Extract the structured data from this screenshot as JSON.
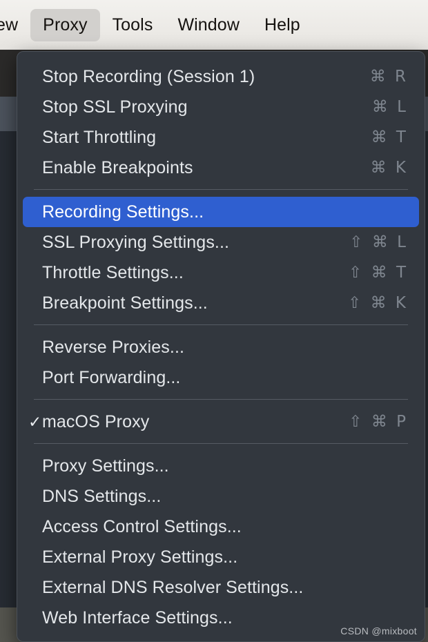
{
  "menubar": {
    "items": [
      {
        "label": "ew",
        "active": false,
        "truncated": true
      },
      {
        "label": "Proxy",
        "active": true,
        "truncated": false
      },
      {
        "label": "Tools",
        "active": false,
        "truncated": false
      },
      {
        "label": "Window",
        "active": false,
        "truncated": false
      },
      {
        "label": "Help",
        "active": false,
        "truncated": false
      }
    ]
  },
  "dropdown": {
    "title": "Proxy",
    "highlight_color": "#2f5fd0",
    "groups": [
      {
        "items": [
          {
            "label": "Stop Recording (Session 1)",
            "shortcut": "⌘ R",
            "checked": false,
            "highlighted": false
          },
          {
            "label": "Stop SSL Proxying",
            "shortcut": "⌘ L",
            "checked": false,
            "highlighted": false
          },
          {
            "label": "Start Throttling",
            "shortcut": "⌘ T",
            "checked": false,
            "highlighted": false
          },
          {
            "label": "Enable Breakpoints",
            "shortcut": "⌘ K",
            "checked": false,
            "highlighted": false
          }
        ]
      },
      {
        "items": [
          {
            "label": "Recording Settings...",
            "shortcut": "",
            "checked": false,
            "highlighted": true
          },
          {
            "label": "SSL Proxying Settings...",
            "shortcut": "⇧ ⌘ L",
            "checked": false,
            "highlighted": false
          },
          {
            "label": "Throttle Settings...",
            "shortcut": "⇧ ⌘ T",
            "checked": false,
            "highlighted": false
          },
          {
            "label": "Breakpoint Settings...",
            "shortcut": "⇧ ⌘ K",
            "checked": false,
            "highlighted": false
          }
        ]
      },
      {
        "items": [
          {
            "label": "Reverse Proxies...",
            "shortcut": "",
            "checked": false,
            "highlighted": false
          },
          {
            "label": "Port Forwarding...",
            "shortcut": "",
            "checked": false,
            "highlighted": false
          }
        ]
      },
      {
        "items": [
          {
            "label": "macOS Proxy",
            "shortcut": "⇧ ⌘ P",
            "checked": true,
            "highlighted": false
          }
        ]
      },
      {
        "items": [
          {
            "label": "Proxy Settings...",
            "shortcut": "",
            "checked": false,
            "highlighted": false
          },
          {
            "label": "DNS Settings...",
            "shortcut": "",
            "checked": false,
            "highlighted": false
          },
          {
            "label": "Access Control Settings...",
            "shortcut": "",
            "checked": false,
            "highlighted": false
          },
          {
            "label": "External Proxy Settings...",
            "shortcut": "",
            "checked": false,
            "highlighted": false
          },
          {
            "label": "External DNS Resolver Settings...",
            "shortcut": "",
            "checked": false,
            "highlighted": false
          },
          {
            "label": "Web Interface Settings...",
            "shortcut": "",
            "checked": false,
            "highlighted": false
          }
        ]
      }
    ],
    "check_glyph": "✓"
  },
  "watermark": {
    "text": "CSDN @mixboot"
  }
}
